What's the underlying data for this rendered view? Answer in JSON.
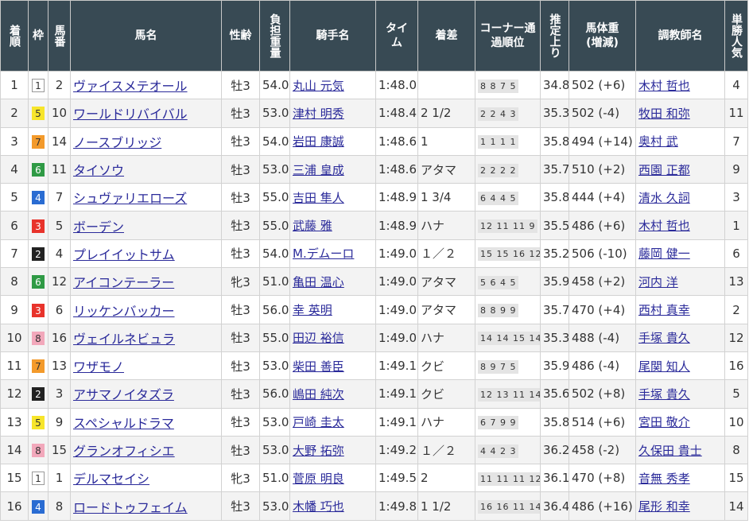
{
  "headers": {
    "chakujun": "着順",
    "waku": "枠",
    "umaban": "馬番",
    "bamei": "馬名",
    "seirei": "性齢",
    "futan": "負担重量",
    "kishu": "騎手名",
    "time": "タイム",
    "chakusa": "着差",
    "corner": "コーナー通過順位",
    "agari": "推定上り",
    "bataiju": "馬体重(増減)",
    "chokyoshi": "調教師名",
    "ninki": "単勝人気"
  },
  "waku_colors": {
    "1": {
      "bg": "#ffffff",
      "fg": "#333333",
      "border": "#999999"
    },
    "2": {
      "bg": "#222222",
      "fg": "#ffffff",
      "border": "#222222"
    },
    "3": {
      "bg": "#e8332b",
      "fg": "#ffffff",
      "border": "#e8332b"
    },
    "4": {
      "bg": "#2a6cd2",
      "fg": "#ffffff",
      "border": "#2a6cd2"
    },
    "5": {
      "bg": "#f7e52b",
      "fg": "#333333",
      "border": "#f7e52b"
    },
    "6": {
      "bg": "#2f9a45",
      "fg": "#ffffff",
      "border": "#2f9a45"
    },
    "7": {
      "bg": "#f39a2b",
      "fg": "#333333",
      "border": "#f39a2b"
    },
    "8": {
      "bg": "#f2a8bb",
      "fg": "#333333",
      "border": "#f2a8bb"
    }
  },
  "rows": [
    {
      "chakujun": "1",
      "waku": "1",
      "umaban": "2",
      "horse": "ヴァイスメテオール",
      "seirei": "牡3",
      "futan": "54.0",
      "jockey": "丸山 元気",
      "time": "1:48.0",
      "margin": "",
      "corner": "8 8 7 5",
      "agari": "34.8",
      "weight": "502 (+6)",
      "trainer": "木村 哲也",
      "ninki": "4"
    },
    {
      "chakujun": "2",
      "waku": "5",
      "umaban": "10",
      "horse": "ワールドリバイバル",
      "seirei": "牡3",
      "futan": "53.0",
      "jockey": "津村 明秀",
      "time": "1:48.4",
      "margin": "2 1/2",
      "corner": "2 2 4 3",
      "agari": "35.3",
      "weight": "502 (-4)",
      "trainer": "牧田 和弥",
      "ninki": "11"
    },
    {
      "chakujun": "3",
      "waku": "7",
      "umaban": "14",
      "horse": "ノースブリッジ",
      "seirei": "牡3",
      "futan": "54.0",
      "jockey": "岩田 康誠",
      "time": "1:48.6",
      "margin": "1",
      "corner": "1 1 1 1",
      "agari": "35.8",
      "weight": "494 (+14)",
      "trainer": "奥村 武",
      "ninki": "7"
    },
    {
      "chakujun": "4",
      "waku": "6",
      "umaban": "11",
      "horse": "タイソウ",
      "seirei": "牡3",
      "futan": "53.0",
      "jockey": "三浦 皇成",
      "time": "1:48.6",
      "margin": "アタマ",
      "corner": "2 2 2 2",
      "agari": "35.7",
      "weight": "510 (+2)",
      "trainer": "西園 正都",
      "ninki": "9"
    },
    {
      "chakujun": "5",
      "waku": "4",
      "umaban": "7",
      "horse": "シュヴァリエローズ",
      "seirei": "牡3",
      "futan": "55.0",
      "jockey": "吉田 隼人",
      "time": "1:48.9",
      "margin": "1 3/4",
      "corner": "6 4 4 5",
      "agari": "35.8",
      "weight": "444 (+4)",
      "trainer": "清水 久詞",
      "ninki": "3"
    },
    {
      "chakujun": "6",
      "waku": "3",
      "umaban": "5",
      "horse": "ボーデン",
      "seirei": "牡3",
      "futan": "55.0",
      "jockey": "武藤 雅",
      "time": "1:48.9",
      "margin": "ハナ",
      "corner": "12 11 11 9",
      "agari": "35.5",
      "weight": "486 (+6)",
      "trainer": "木村 哲也",
      "ninki": "1"
    },
    {
      "chakujun": "7",
      "waku": "2",
      "umaban": "4",
      "horse": "プレイイットサム",
      "seirei": "牡3",
      "futan": "54.0",
      "jockey": "M.デムーロ",
      "time": "1:49.0",
      "margin": "１／２",
      "corner": "15 15 16 12",
      "agari": "35.2",
      "weight": "506 (-10)",
      "trainer": "藤岡 健一",
      "ninki": "6"
    },
    {
      "chakujun": "8",
      "waku": "6",
      "umaban": "12",
      "horse": "アイコンテーラー",
      "seirei": "牝3",
      "futan": "51.0",
      "jockey": "亀田 温心",
      "time": "1:49.0",
      "margin": "アタマ",
      "corner": "5 6 4 5",
      "agari": "35.9",
      "weight": "458 (+2)",
      "trainer": "河内 洋",
      "ninki": "13"
    },
    {
      "chakujun": "9",
      "waku": "3",
      "umaban": "6",
      "horse": "リッケンバッカー",
      "seirei": "牡3",
      "futan": "56.0",
      "jockey": "幸 英明",
      "time": "1:49.0",
      "margin": "アタマ",
      "corner": "8 8 9 9",
      "agari": "35.7",
      "weight": "470 (+4)",
      "trainer": "西村 真幸",
      "ninki": "2"
    },
    {
      "chakujun": "10",
      "waku": "8",
      "umaban": "16",
      "horse": "ヴェイルネビュラ",
      "seirei": "牡3",
      "futan": "55.0",
      "jockey": "田辺 裕信",
      "time": "1:49.0",
      "margin": "ハナ",
      "corner": "14 14 15 14",
      "agari": "35.3",
      "weight": "488 (-4)",
      "trainer": "手塚 貴久",
      "ninki": "12"
    },
    {
      "chakujun": "11",
      "waku": "7",
      "umaban": "13",
      "horse": "ワザモノ",
      "seirei": "牡3",
      "futan": "53.0",
      "jockey": "柴田 善臣",
      "time": "1:49.1",
      "margin": "クビ",
      "corner": "8 9 7 5",
      "agari": "35.9",
      "weight": "486 (-4)",
      "trainer": "尾関 知人",
      "ninki": "16"
    },
    {
      "chakujun": "12",
      "waku": "2",
      "umaban": "3",
      "horse": "アサマノイタズラ",
      "seirei": "牡3",
      "futan": "56.0",
      "jockey": "嶋田 純次",
      "time": "1:49.1",
      "margin": "クビ",
      "corner": "12 13 11 14",
      "agari": "35.6",
      "weight": "502 (+8)",
      "trainer": "手塚 貴久",
      "ninki": "5"
    },
    {
      "chakujun": "13",
      "waku": "5",
      "umaban": "9",
      "horse": "スペシャルドラマ",
      "seirei": "牡3",
      "futan": "53.0",
      "jockey": "戸崎 圭太",
      "time": "1:49.1",
      "margin": "ハナ",
      "corner": "6 7 9 9",
      "agari": "35.8",
      "weight": "514 (+6)",
      "trainer": "宮田 敬介",
      "ninki": "10"
    },
    {
      "chakujun": "14",
      "waku": "8",
      "umaban": "15",
      "horse": "グランオフィシエ",
      "seirei": "牡3",
      "futan": "53.0",
      "jockey": "大野 拓弥",
      "time": "1:49.2",
      "margin": "１／２",
      "corner": "4 4 2 3",
      "agari": "36.2",
      "weight": "458 (-2)",
      "trainer": "久保田 貴士",
      "ninki": "8"
    },
    {
      "chakujun": "15",
      "waku": "1",
      "umaban": "1",
      "horse": "デルマセイシ",
      "seirei": "牝3",
      "futan": "51.0",
      "jockey": "菅原 明良",
      "time": "1:49.5",
      "margin": "2",
      "corner": "11 11 11 12",
      "agari": "36.1",
      "weight": "470 (+8)",
      "trainer": "音無 秀孝",
      "ninki": "15"
    },
    {
      "chakujun": "16",
      "waku": "4",
      "umaban": "8",
      "horse": "ロードトゥフェイム",
      "seirei": "牡3",
      "futan": "53.0",
      "jockey": "木幡 巧也",
      "time": "1:49.8",
      "margin": "1 1/2",
      "corner": "16 16 11 14",
      "agari": "36.4",
      "weight": "486 (+16)",
      "trainer": "尾形 和幸",
      "ninki": "14"
    }
  ]
}
